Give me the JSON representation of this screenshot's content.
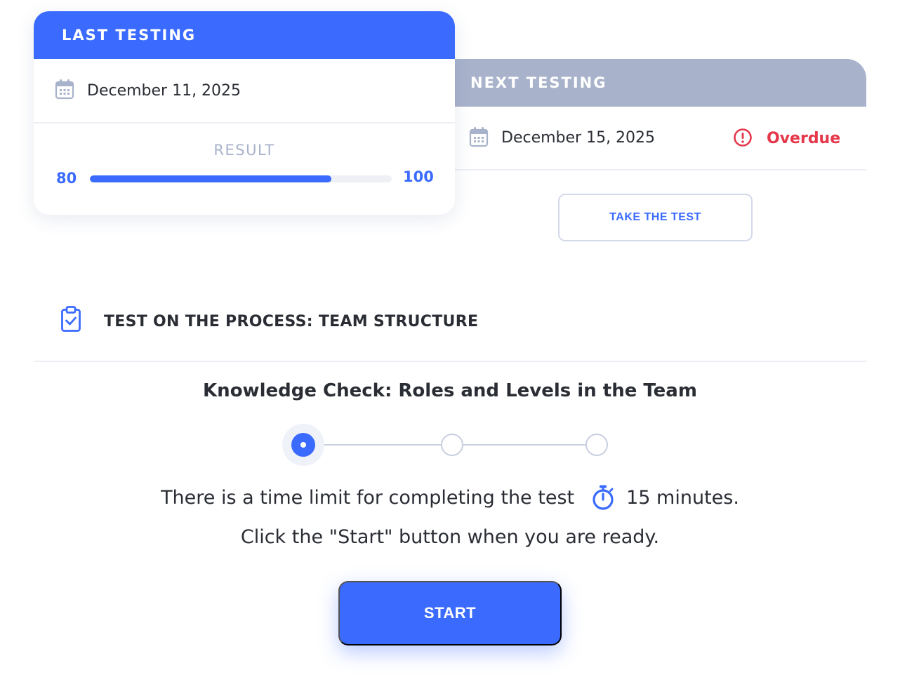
{
  "last_testing": {
    "header": "LAST TESTING",
    "date": "December 11, 2025",
    "result_label": "RESULT",
    "score": 80,
    "max_score": 100
  },
  "next_testing": {
    "header": "NEXT TESTING",
    "date": "December 15, 2025",
    "status": "Overdue",
    "action": "TAKE THE TEST"
  },
  "test": {
    "title": "TEST ON THE PROCESS: TEAM STRUCTURE",
    "subtitle": "Knowledge Check: Roles and Levels in the Team",
    "steps_total": 3,
    "current_step": 1,
    "time_limit_text": "There is a time limit for completing the test",
    "time_limit_value": "15 minutes.",
    "instruction": "Click the \"Start\" button when you are ready.",
    "start_label": "START"
  },
  "colors": {
    "primary": "#3b6bfe",
    "muted": "#a8b2cb",
    "danger": "#e5374a",
    "text": "#2a2d34"
  },
  "icons": [
    "calendar-icon",
    "alert-circle-icon",
    "clipboard-check-icon",
    "stopwatch-icon"
  ]
}
